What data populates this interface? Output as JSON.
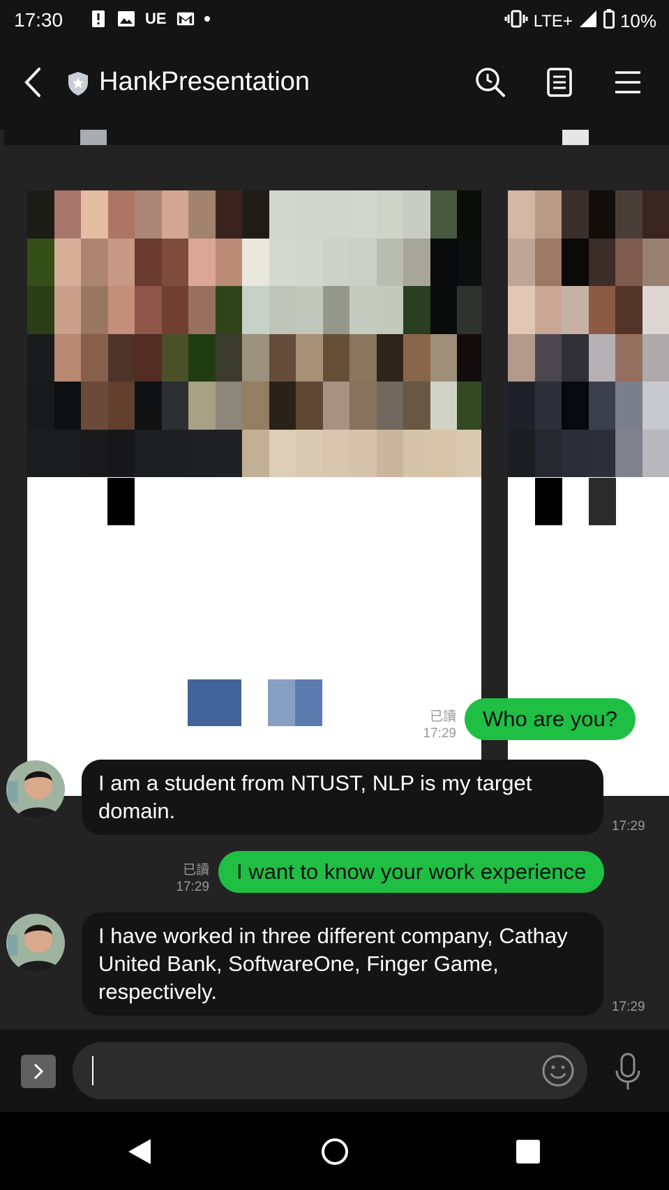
{
  "status_bar": {
    "time": "17:30",
    "carrier_icon_text": "UE",
    "network": "LTE+",
    "battery": "10%",
    "icons": [
      "alert-icon",
      "image-icon",
      "gmail-icon",
      "dot-icon",
      "vibrate-icon",
      "signal-icon",
      "battery-icon"
    ]
  },
  "header": {
    "title": "HankPresentation",
    "icons": [
      "back-icon",
      "shield-icon",
      "search-icon",
      "notes-icon",
      "menu-icon"
    ]
  },
  "messages": [
    {
      "direction": "out",
      "text": "Who are you?",
      "read_label": "已讀",
      "time": "17:29"
    },
    {
      "direction": "in",
      "text": "I am a student from NTUST, NLP is my target domain.",
      "time": "17:29"
    },
    {
      "direction": "out",
      "text": "I want to know your work experience",
      "read_label": "已讀",
      "time": "17:29"
    },
    {
      "direction": "in",
      "text": "I have worked in three different company, Cathay United Bank, SoftwareOne, Finger Game, respectively.",
      "time": "17:29"
    }
  ],
  "input_bar": {
    "value": "",
    "icons": [
      "expand-icon",
      "emoji-icon",
      "microphone-icon"
    ]
  },
  "nav_bar": {
    "icons": [
      "nav-back-icon",
      "nav-home-icon",
      "nav-recents-icon"
    ]
  },
  "colors": {
    "chat_bg": "#232323",
    "outgoing_bubble": "#1fbf44",
    "incoming_bubble": "#141414",
    "header_bg": "#141414"
  }
}
